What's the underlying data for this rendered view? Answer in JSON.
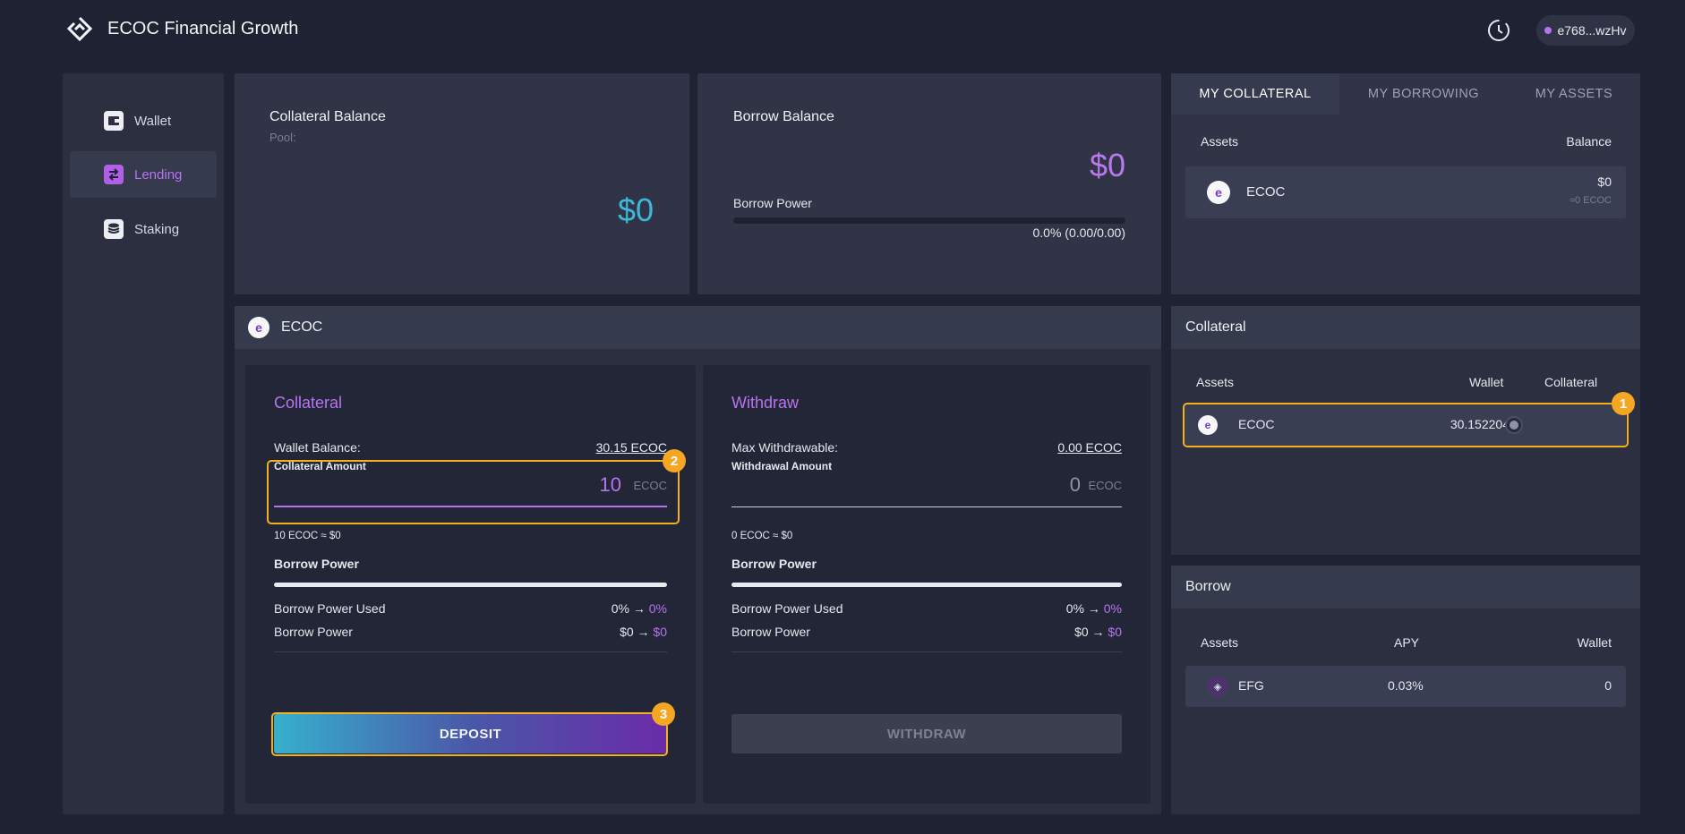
{
  "header": {
    "title": "ECOC Financial Growth",
    "wallet_address": "e768...wzHv",
    "icons": {
      "logo": "ecoc-logo",
      "history": "clock-history-icon"
    }
  },
  "sidebar": {
    "items": [
      {
        "label": "Wallet",
        "icon": "wallet-icon",
        "active": false
      },
      {
        "label": "Lending",
        "icon": "swap-icon",
        "active": true
      },
      {
        "label": "Staking",
        "icon": "stack-icon",
        "active": false
      }
    ]
  },
  "collateral_balance": {
    "title": "Collateral Balance",
    "pool_label": "Pool:",
    "value": "$0"
  },
  "borrow_balance": {
    "title": "Borrow Balance",
    "value": "$0",
    "power_label": "Borrow Power",
    "power_value": "0.0% (0.00/0.00)",
    "power_fraction": 0
  },
  "tabs": {
    "items": [
      "MY COLLATERAL",
      "MY BORROWING",
      "MY ASSETS"
    ],
    "active_index": 0
  },
  "my_collateral": {
    "col_assets": "Assets",
    "col_balance": "Balance",
    "rows": [
      {
        "asset": "ECOC",
        "value": "$0",
        "sub_value": "≈0 ECOC"
      }
    ]
  },
  "asset_panel": {
    "name": "ECOC"
  },
  "collateral_form": {
    "title": "Collateral",
    "wallet_balance_label": "Wallet Balance:",
    "wallet_balance_value": "30.15 ECOC",
    "amount_label": "Collateral Amount",
    "amount_value": "10",
    "unit": "ECOC",
    "conversion": "10 ECOC ≈ $0",
    "power_title": "Borrow Power",
    "used_label": "Borrow Power Used",
    "used_from": "0% →",
    "used_to": "0%",
    "power_label": "Borrow Power",
    "power_from": "$0 →",
    "power_to": "$0",
    "button": "DEPOSIT"
  },
  "withdraw_form": {
    "title": "Withdraw",
    "max_label": "Max Withdrawable:",
    "max_value": "0.00 ECOC",
    "amount_label": "Withdrawal Amount",
    "amount_value": "0",
    "unit": "ECOC",
    "conversion": "0 ECOC ≈ $0",
    "power_title": "Borrow Power",
    "used_label": "Borrow Power Used",
    "used_from": "0% →",
    "used_to": "0%",
    "power_label": "Borrow Power",
    "power_from": "$0 →",
    "power_to": "$0",
    "button": "WITHDRAW"
  },
  "collateral_section": {
    "title": "Collateral",
    "col_assets": "Assets",
    "col_wallet": "Wallet",
    "col_collateral": "Collateral",
    "rows": [
      {
        "asset": "ECOC",
        "wallet": "30.152204"
      }
    ]
  },
  "borrow_section": {
    "title": "Borrow",
    "col_assets": "Assets",
    "col_apy": "APY",
    "col_wallet": "Wallet",
    "rows": [
      {
        "asset": "EFG",
        "apy": "0.03%",
        "wallet": "0"
      }
    ]
  },
  "annotations": [
    "1",
    "2",
    "3"
  ],
  "colors": {
    "accent": "#b774f0",
    "cyan": "#3fb7d6",
    "highlight": "#f3b21c",
    "badge": "#f5a623"
  }
}
